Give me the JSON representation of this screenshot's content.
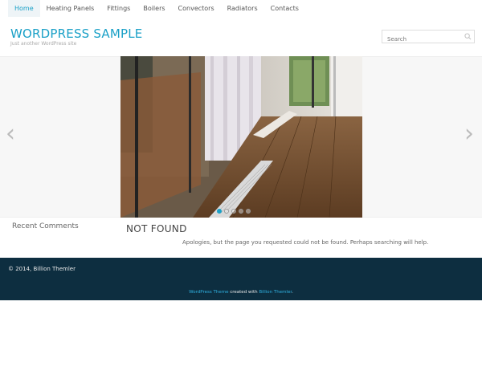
{
  "nav": {
    "items": [
      {
        "label": "Home"
      },
      {
        "label": "Heating Panels"
      },
      {
        "label": "Fittings"
      },
      {
        "label": "Boilers"
      },
      {
        "label": "Convectors"
      },
      {
        "label": "Radiators"
      },
      {
        "label": "Contacts"
      }
    ],
    "active_index": 0
  },
  "header": {
    "title": "WORDPRESS SAMPLE",
    "tagline": "Just another WordPress site",
    "search_placeholder": "Search"
  },
  "slider": {
    "prev_label": "‹",
    "next_label": "›",
    "slide_count": 5,
    "active_slide": 1
  },
  "sidebar": {
    "widget_title": "Recent Comments"
  },
  "main": {
    "title": "NOT FOUND",
    "message": "Apologies, but the page you requested could not be found. Perhaps searching will help."
  },
  "footer": {
    "copyright": "© 2014, Billion Themler",
    "credit_link1": "WordPress Theme",
    "credit_mid": " created with ",
    "credit_link2": "Billion Themler",
    "credit_end": "."
  },
  "colors": {
    "accent": "#1aa0c7",
    "footer_bg": "#0d2e40"
  }
}
